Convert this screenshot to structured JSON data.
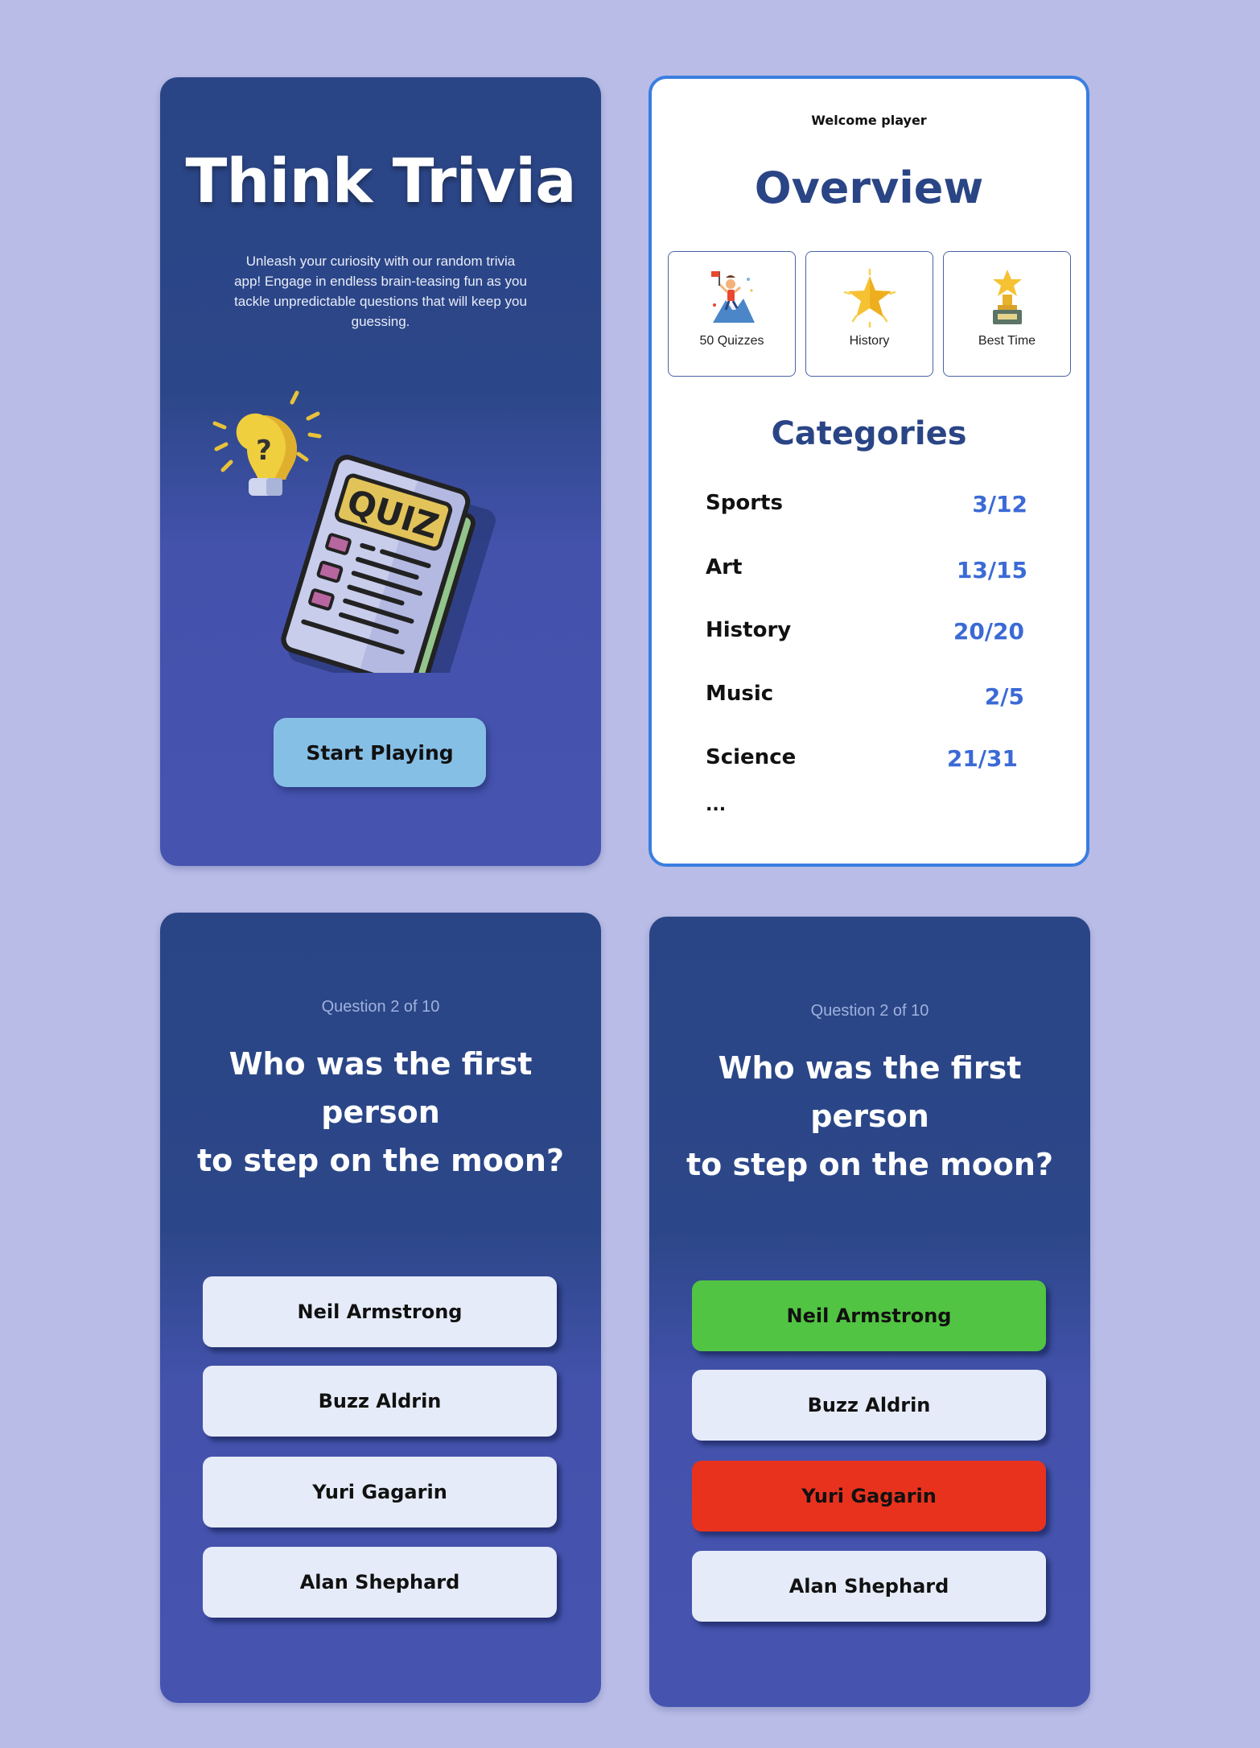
{
  "intro": {
    "title": "Think Trivia",
    "tagline": "Unleash your curiosity with our random trivia app! Engage in endless brain-teasing fun as you tackle unpredictable questions that will keep you guessing.",
    "illustration_text": "QUIZ",
    "lightbulb_symbol": "?",
    "start_button": "Start Playing"
  },
  "overview": {
    "welcome": "Welcome player",
    "title": "Overview",
    "tiles": [
      {
        "label": "50 Quizzes",
        "icon": "climber-flag-icon"
      },
      {
        "label": "History",
        "icon": "star-icon"
      },
      {
        "label": "Best Time",
        "icon": "trophy-icon"
      }
    ],
    "categories_title": "Categories",
    "categories": [
      {
        "name": "Sports",
        "score": "3/12"
      },
      {
        "name": "Art",
        "score": "13/15"
      },
      {
        "name": "History",
        "score": "20/20"
      },
      {
        "name": "Music",
        "score": "2/5"
      },
      {
        "name": "Science",
        "score": "21/31"
      }
    ],
    "more": "..."
  },
  "question_screens": [
    {
      "counter": "Question 2 of 10",
      "question": "Who was the first\nperson\nto step on the moon?",
      "answers": [
        {
          "label": "Neil Armstrong",
          "state": "neutral"
        },
        {
          "label": "Buzz Aldrin",
          "state": "neutral"
        },
        {
          "label": "Yuri Gagarin",
          "state": "neutral"
        },
        {
          "label": "Alan Shephard",
          "state": "neutral"
        }
      ]
    },
    {
      "counter": "Question 2 of 10",
      "question": "Who was the first\nperson\nto step on the moon?",
      "answers": [
        {
          "label": "Neil Armstrong",
          "state": "correct"
        },
        {
          "label": "Buzz Aldrin",
          "state": "neutral"
        },
        {
          "label": "Yuri Gagarin",
          "state": "wrong"
        },
        {
          "label": "Alan Shephard",
          "state": "neutral"
        }
      ]
    }
  ],
  "colors": {
    "background": "#b8bce6",
    "card_blue_top": "#2a4585",
    "card_blue_bottom": "#4654b0",
    "heading_blue": "#2a4585",
    "score_blue": "#3b6ad6",
    "start_button": "#86bfe6",
    "answer_neutral": "#e5ebf8",
    "answer_correct": "#52c443",
    "answer_wrong": "#e8321e"
  }
}
